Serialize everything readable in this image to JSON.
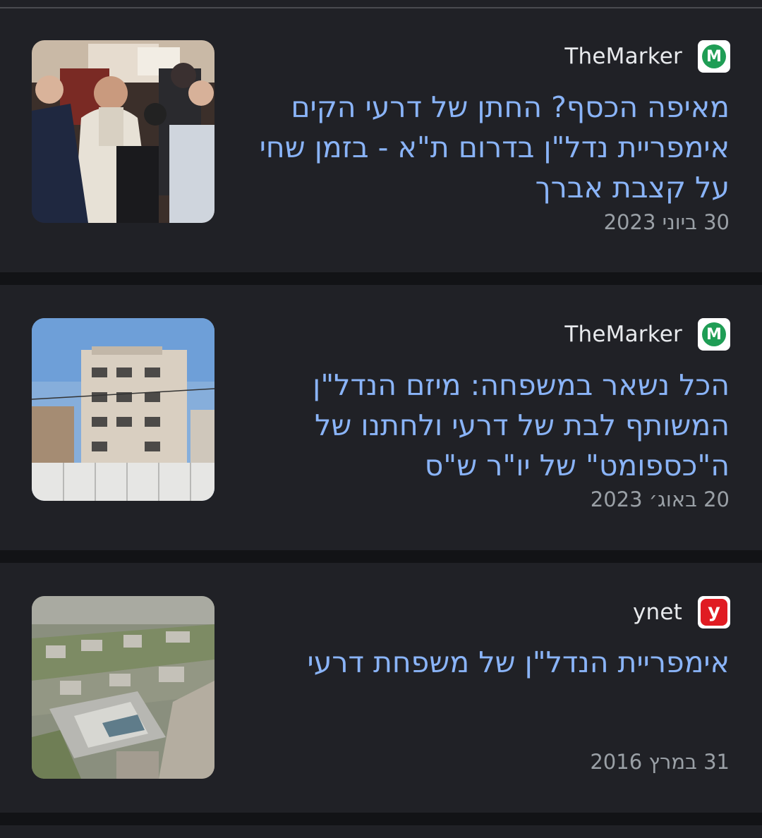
{
  "articles": [
    {
      "source": "TheMarker",
      "source_logo_icon": "themarker-logo-icon",
      "source_logo_letter": "M",
      "headline": "מאיפה הכסף? החתן של דרעי הקים אימפריית נדל\"ן בדרום ת\"א - בזמן שחי על קצבת אברך",
      "date": "30 ביוני 2023",
      "thumbnail": "wedding-ceremony-photo"
    },
    {
      "source": "TheMarker",
      "source_logo_icon": "themarker-logo-icon",
      "source_logo_letter": "M",
      "headline": "הכל נשאר במשפחה: מיזם הנדל\"ן המשותף לבת של דרעי ולחתנו של ה\"כספומט\" של יו\"ר ש\"ס",
      "date": "20 באוג׳ 2023",
      "thumbnail": "apartment-building-photo"
    },
    {
      "source": "ynet",
      "source_logo_icon": "ynet-logo-icon",
      "source_logo_letter": "y",
      "headline": "אימפריית הנדל\"ן של משפחת דרעי",
      "date": "31 במרץ 2016",
      "thumbnail": "aerial-neighborhood-photo"
    }
  ],
  "colors": {
    "card_background": "#202126",
    "page_background": "#121316",
    "headline": "#8ab4f8",
    "source_text": "#e8eaed",
    "date_text": "#9aa0a6",
    "themarker_green": "#1f9d55",
    "ynet_red": "#e01b22"
  }
}
